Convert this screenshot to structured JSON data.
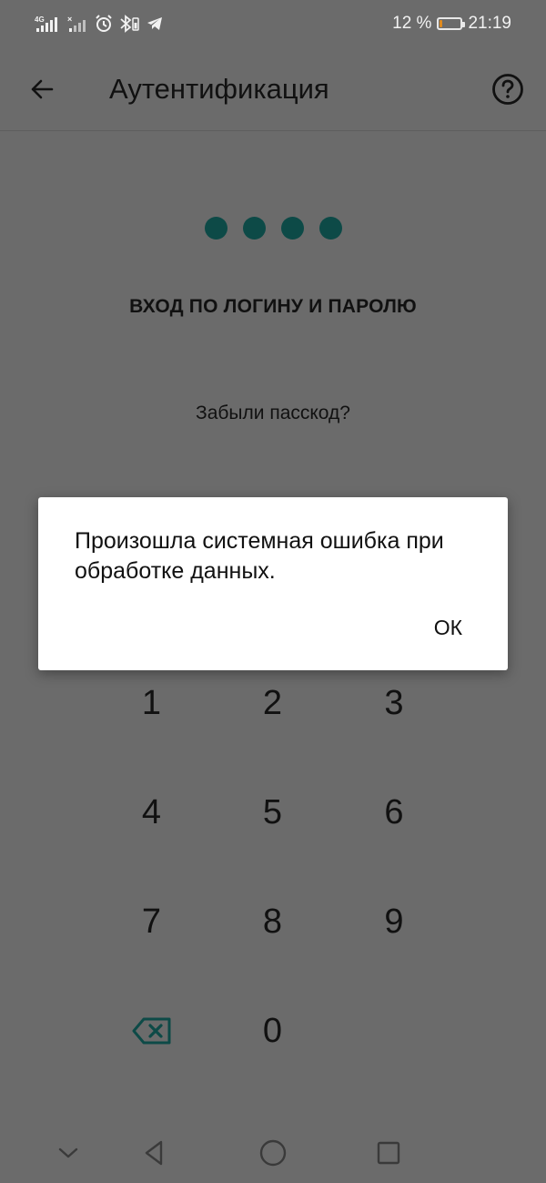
{
  "status_bar": {
    "network_label": "4G",
    "battery_percent": "12 %",
    "time": "21:19",
    "battery_level": 0.12,
    "battery_fill_color": "#e08a1e"
  },
  "app_bar": {
    "title": "Аутентификация",
    "back_icon": "arrow-left-icon",
    "help_icon": "question-circle-icon"
  },
  "pin": {
    "entered_count": 4,
    "dot_color": "#0d4a47"
  },
  "login_link": "ВХОД ПО ЛОГИНУ И ПАРОЛЮ",
  "forgot_link": "Забыли пасскод?",
  "keypad": {
    "keys": [
      "1",
      "2",
      "3",
      "4",
      "5",
      "6",
      "7",
      "8",
      "9",
      "",
      "0",
      ""
    ],
    "backspace_icon": "backspace-icon",
    "backspace_color": "#0d4a47"
  },
  "dialog": {
    "message": "Произошла системная ошибка при обработке данных.",
    "ok_label": "ОК"
  },
  "nav_bar": {
    "icons": [
      "chevron-down-icon",
      "back-triangle-icon",
      "home-circle-icon",
      "recents-square-icon"
    ]
  }
}
